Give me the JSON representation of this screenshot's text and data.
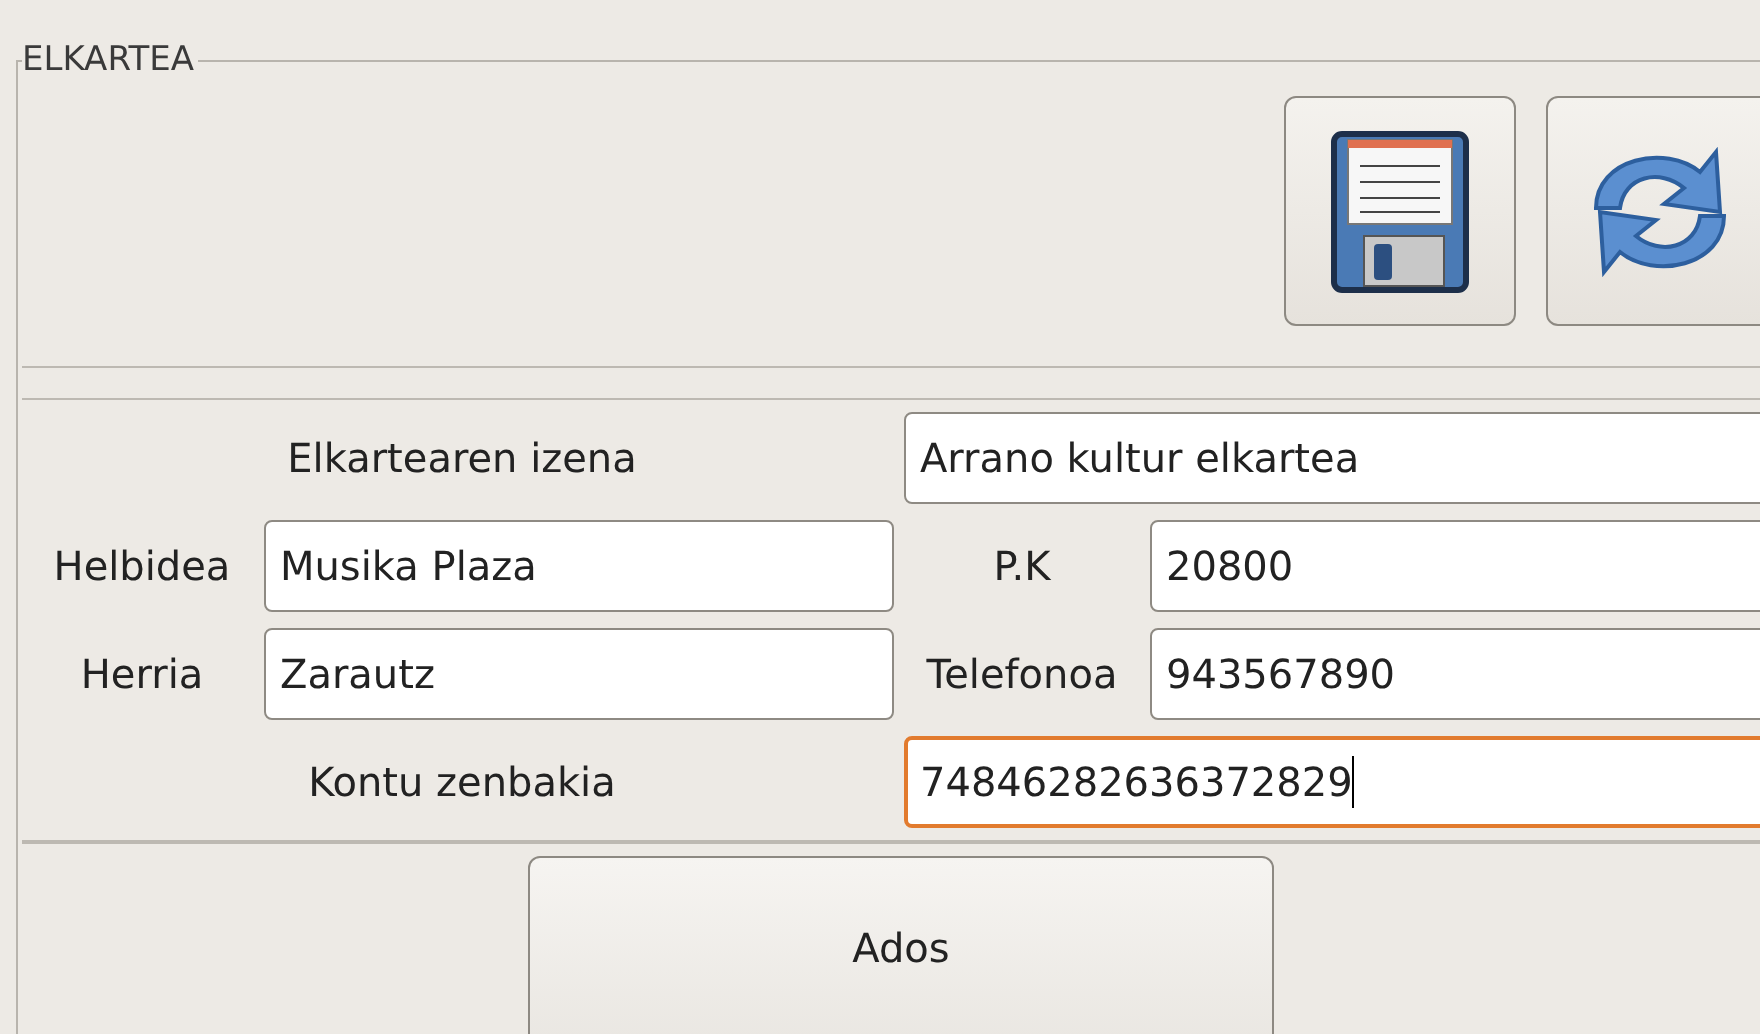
{
  "group": {
    "title": "ELKARTEA"
  },
  "toolbar": [
    {
      "kind": "save"
    },
    {
      "kind": "refresh"
    }
  ],
  "form": [
    {
      "label": "Elkartearen izena",
      "value": "Arrano kultur elkartea",
      "kind": "wide",
      "focused": false
    },
    {
      "label": "Helbidea",
      "value": "Musika Plaza",
      "kind": "left",
      "focused": false
    },
    {
      "label": "P.K",
      "value": "20800",
      "kind": "right",
      "focused": false
    },
    {
      "label": "Herria",
      "value": "Zarautz",
      "kind": "left",
      "focused": false
    },
    {
      "label": "Telefonoa",
      "value": "943567890",
      "kind": "right",
      "focused": false
    },
    {
      "label": "Kontu zenbakia",
      "value": "74846282636372829",
      "kind": "wide",
      "focused": true
    }
  ],
  "ok_button": {
    "label": "Ados"
  }
}
